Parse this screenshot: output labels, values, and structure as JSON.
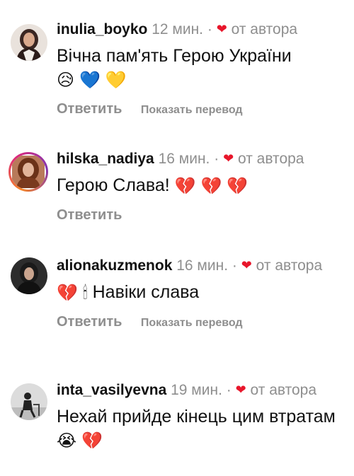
{
  "comments": [
    {
      "username": "inulia_boyko",
      "time": "12 мин.",
      "separator": "·",
      "heart_icon": "heart-icon",
      "by_author": "от автора",
      "text": "Вічна пам'ять Герою України",
      "emojis": [
        "😥",
        "💙",
        "💛"
      ],
      "reply_label": "Ответить",
      "translate_label": "Показать перевод"
    },
    {
      "username": "hilska_nadiya",
      "time": "16 мин.",
      "separator": "·",
      "heart_icon": "heart-icon",
      "by_author": "от автора",
      "text": "Герою Слава!",
      "emojis": [
        "💔",
        "💔",
        "💔"
      ],
      "reply_label": "Ответить"
    },
    {
      "username": "alionakuzmenok",
      "time": "16 мин.",
      "separator": "·",
      "heart_icon": "heart-icon",
      "by_author": "от автора",
      "text": "Навіки слава",
      "emojis": [
        "💔",
        "🕯"
      ],
      "reply_label": "Ответить",
      "translate_label": "Показать перевод"
    },
    {
      "username": "inta_vasilyevna",
      "time": "19 мин.",
      "separator": "·",
      "heart_icon": "heart-icon",
      "by_author": "от автора",
      "text": "Нехай прийде кінець цим втратам",
      "emojis": [
        "😭",
        "💔"
      ]
    }
  ],
  "colors": {
    "text": "#111111",
    "secondary": "#8e8e8e",
    "heart": "#e8162b"
  }
}
